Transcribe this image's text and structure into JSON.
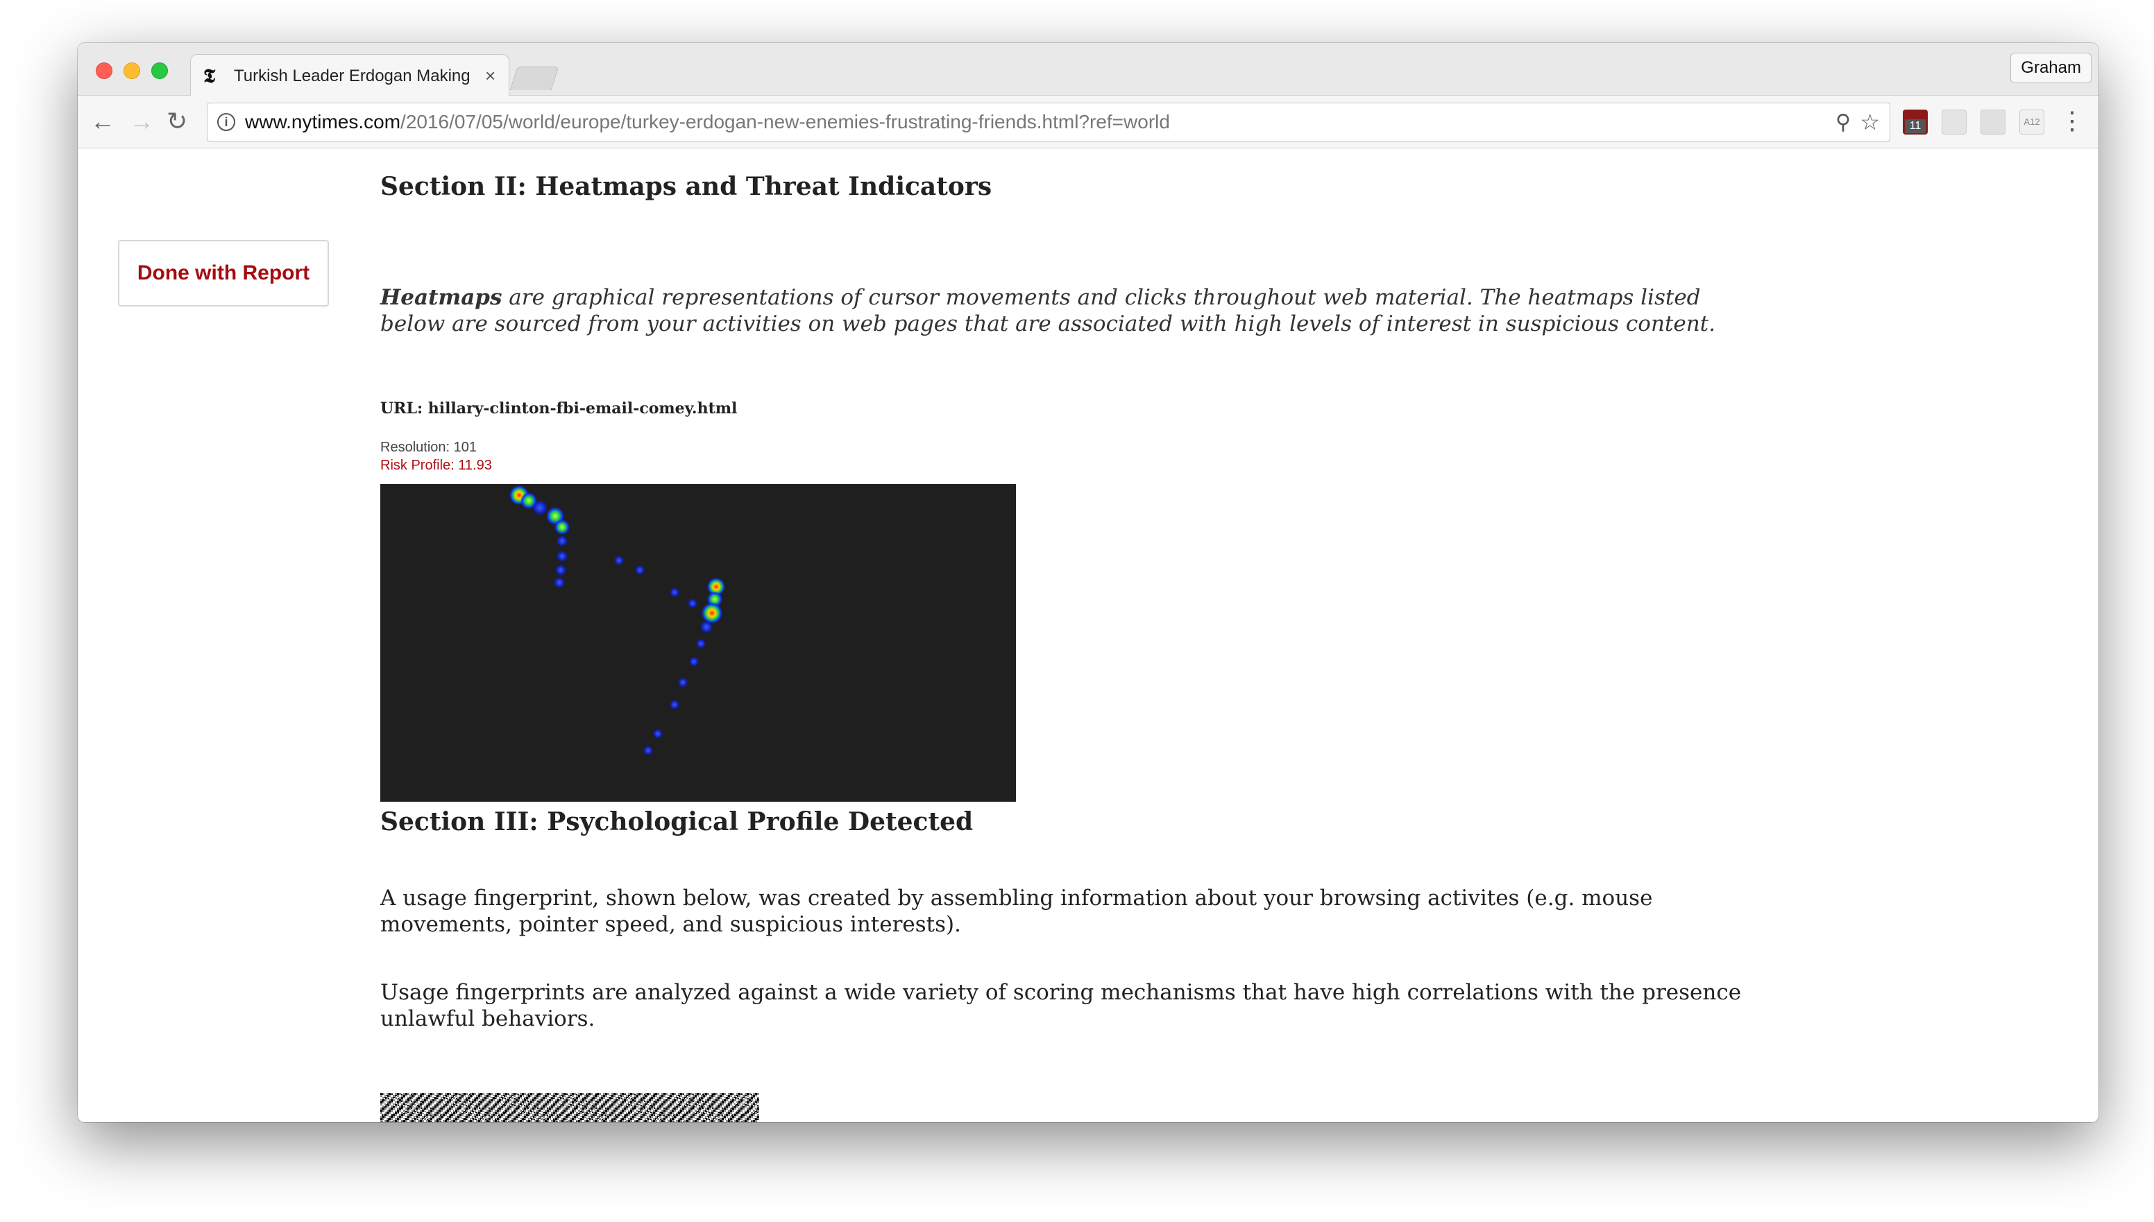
{
  "browser": {
    "tab_title": "Turkish Leader Erdogan Making",
    "tab_favicon": "𝕿",
    "tab_close": "×",
    "profile_name": "Graham",
    "url_host": "www.nytimes.com",
    "url_path": "/2016/07/05/world/europe/turkey-erdogan-new-enemies-frustrating-friends.html?ref=world",
    "back_icon": "←",
    "forward_icon": "→",
    "reload_icon": "↻",
    "info_icon": "i",
    "zoom_icon": "⚲",
    "star_icon": "☆",
    "menu_icon": "⋮",
    "calendar_badge": "11",
    "ext_label": "A12"
  },
  "page": {
    "done_button": "Done with Report",
    "section2_title": "Section II: Heatmaps and Threat Indicators",
    "intro_lead": "Heatmaps",
    "intro_text": " are graphical representations of cursor movements and clicks throughout web material. The heatmaps listed below are sourced from your activities on web pages that are associated with high levels of interest in suspicious content.",
    "heatmap_url": "URL: hillary-clinton-fbi-email-comey.html",
    "resolution": "Resolution: 101",
    "risk_profile": "Risk Profile: 11.93",
    "section3_title": "Section III: Psychological Profile Detected",
    "para1": "A usage fingerprint, shown below, was created by assembling information about your browsing activites (e.g. mouse movements, pointer speed, and suspicious interests).",
    "para2": "Usage fingerprints are analyzed against a wide variety of scoring mechanisms that have high correlations with the presence unlawful behaviors."
  },
  "colors": {
    "accent_red": "#a50c10",
    "heatmap_bg": "#1f1f1f"
  }
}
